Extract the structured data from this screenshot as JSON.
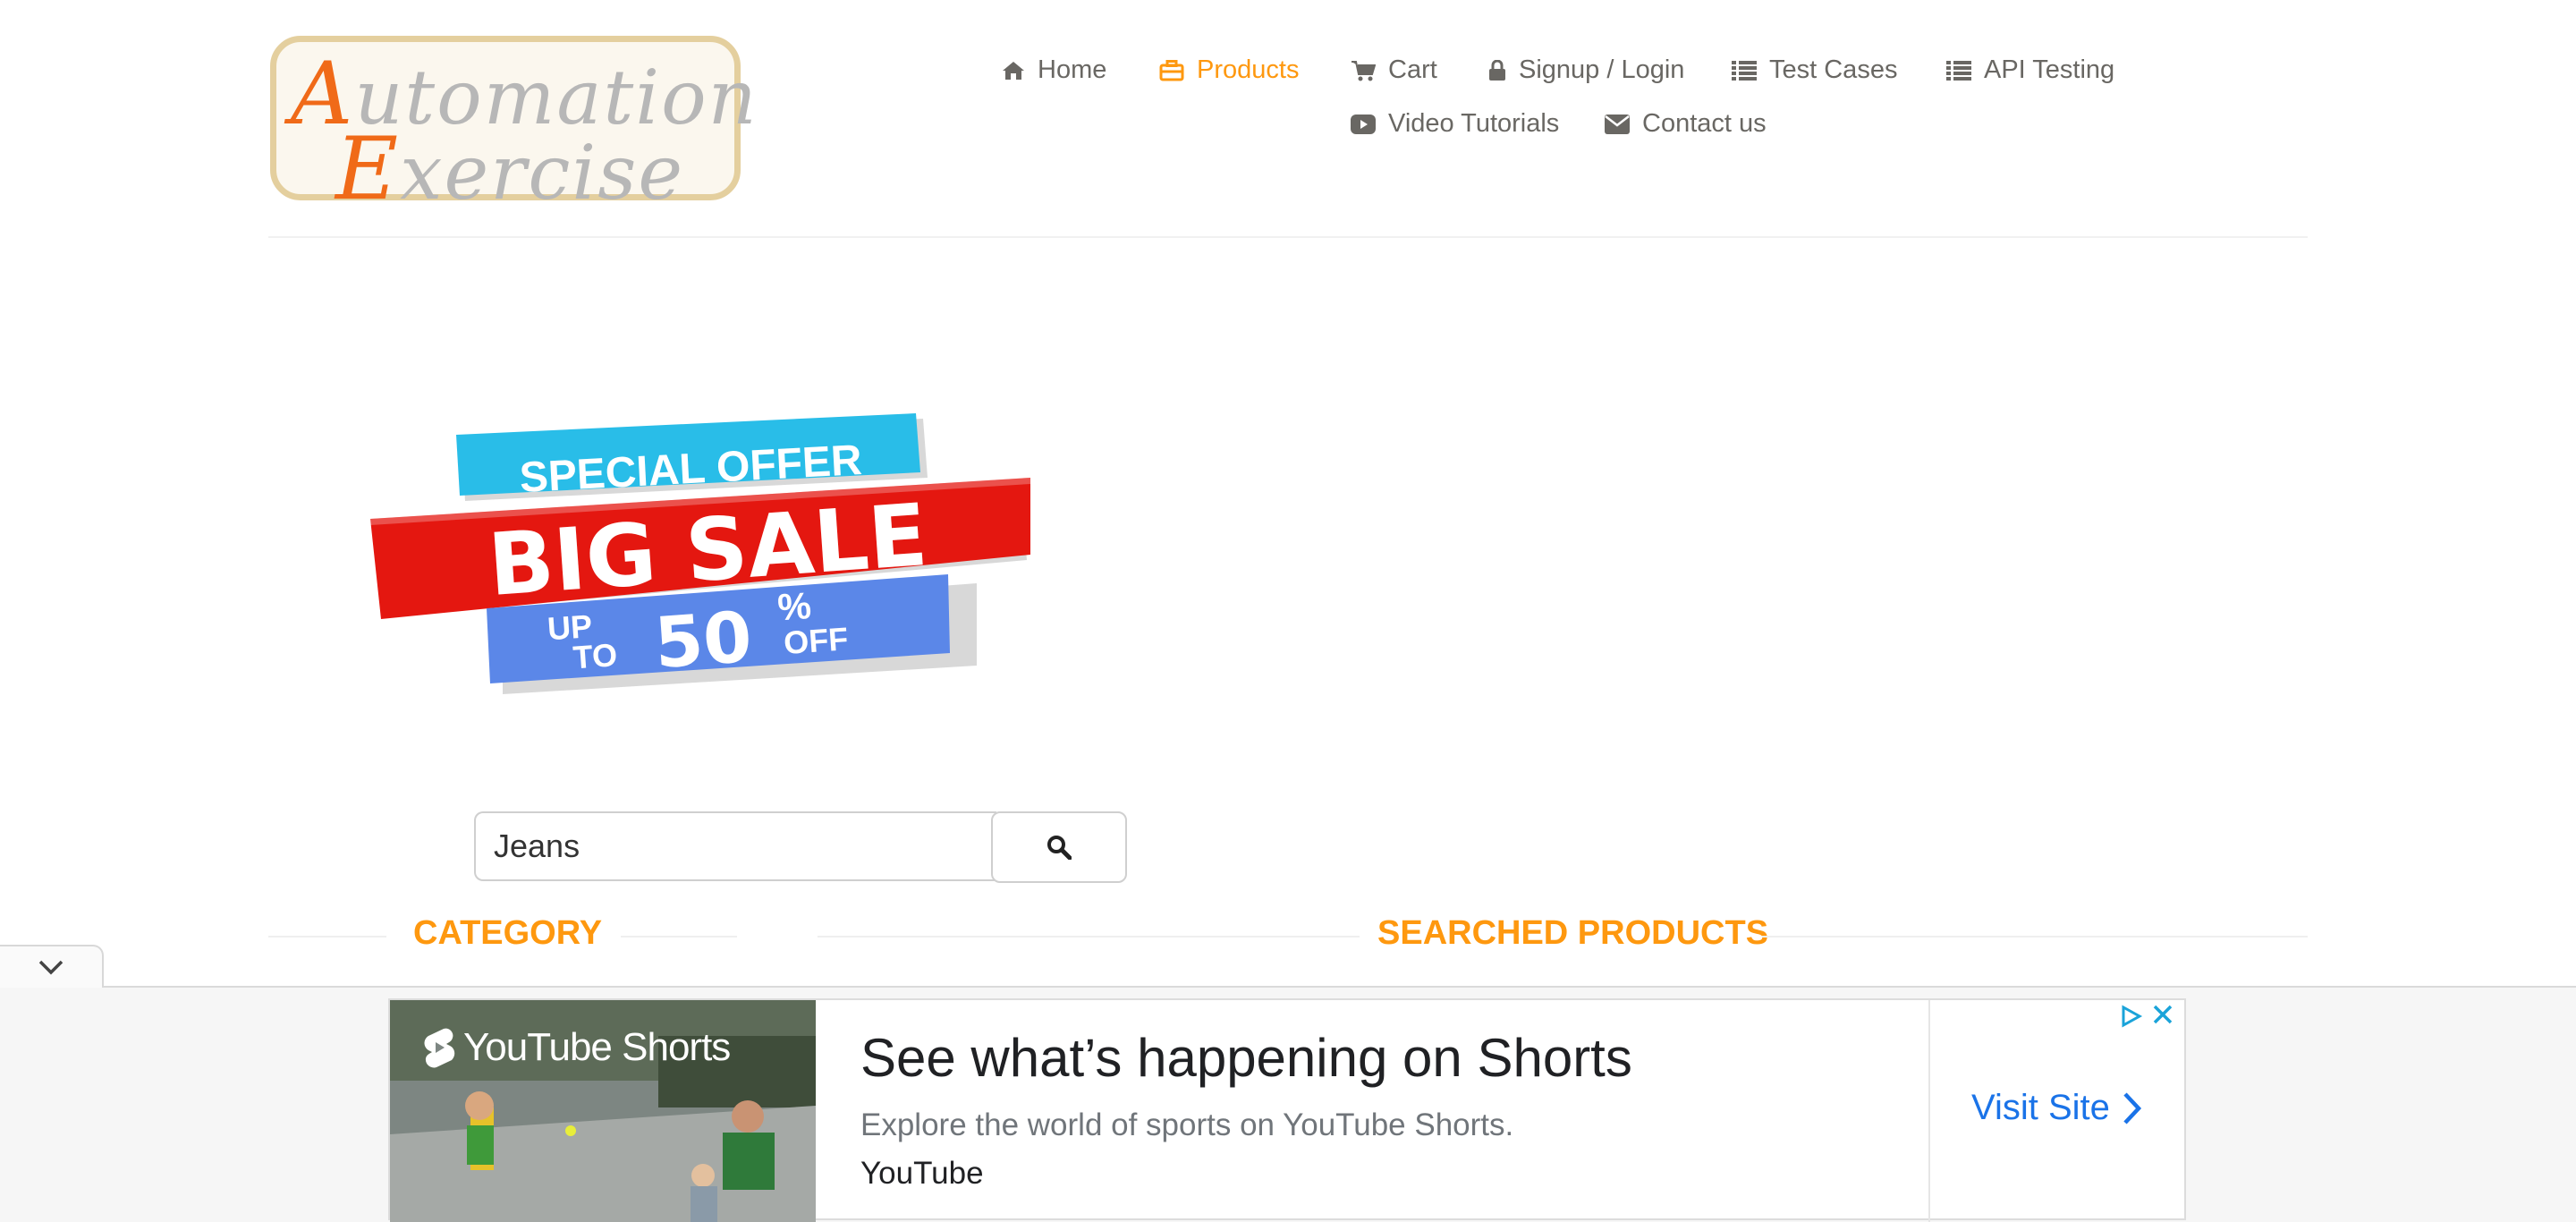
{
  "logo": {
    "line1_cap": "A",
    "line1_rest": "utomation",
    "line2_cap": "E",
    "line2_rest": "xercise"
  },
  "nav": {
    "home": "Home",
    "products": "Products",
    "cart": "Cart",
    "signup": "Signup / Login",
    "test_cases": "Test Cases",
    "api_testing": "API Testing",
    "video_tutorials": "Video Tutorials",
    "contact": "Contact us"
  },
  "banner": {
    "special_offer": "SPECIAL OFFER",
    "big_sale": "BIG SALE",
    "up": "UP",
    "to": "TO",
    "fifty": "50",
    "percent": "%",
    "off": "OFF"
  },
  "search": {
    "value": "Jeans"
  },
  "sections": {
    "category": "CATEGORY",
    "searched_products": "SEARCHED PRODUCTS"
  },
  "ad": {
    "image_brand": "YouTube Shorts",
    "headline": "See what’s happening on Shorts",
    "description": "Explore the world of sports on YouTube Shorts.",
    "advertiser": "YouTube",
    "cta": "Visit Site"
  },
  "colors": {
    "accent": "#fe980f",
    "text": "#696763",
    "link_blue": "#1a73e8"
  },
  "icons": {
    "home": "home-icon",
    "products": "briefcase-icon",
    "cart": "cart-icon",
    "signup": "lock-icon",
    "test_cases": "list-icon",
    "api_testing": "list-icon",
    "video_tutorials": "youtube-play-icon",
    "contact": "envelope-icon",
    "search": "search-icon"
  }
}
